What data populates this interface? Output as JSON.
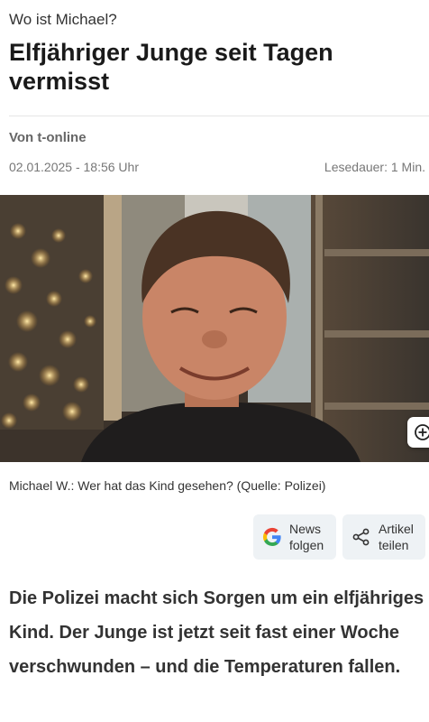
{
  "article": {
    "kicker": "Wo ist Michael?",
    "headline": "Elfjähriger Junge seit Tagen vermisst",
    "author": "Von t-online",
    "date": "02.01.2025 - 18:56 Uhr",
    "read_time": "Lesedauer: 1 Min.",
    "image_caption": "Michael W.: Wer hat das Kind gesehen? (Quelle: Polizei)",
    "lead": "Die Polizei macht sich Sorgen um ein elfjähriges Kind. Der Junge ist jetzt seit fast einer Woche verschwunden – und die Temperaturen fallen."
  },
  "actions": {
    "news_line1": "News",
    "news_line2": "folgen",
    "share_line1": "Artikel",
    "share_line2": "teilen"
  },
  "icons": {
    "zoom": "zoom-in-icon",
    "google": "google-icon",
    "share": "share-icon"
  }
}
